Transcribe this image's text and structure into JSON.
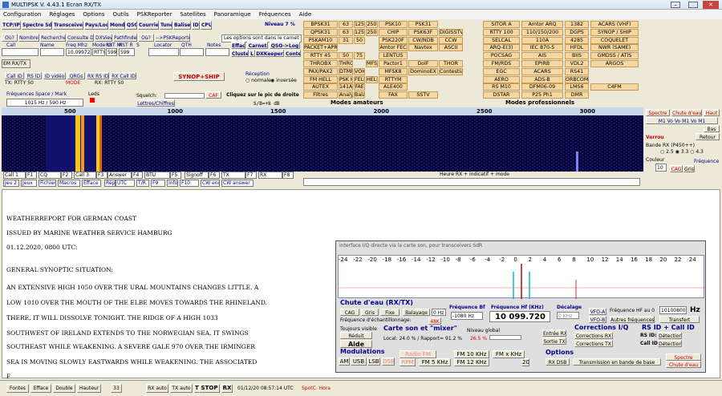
{
  "window": {
    "title": "MULTIPSK V. 4.43.1  Ecran RX/TX"
  },
  "menu": [
    "Configuration",
    "Réglages",
    "Options",
    "Outils",
    "PSKReporter",
    "Satellites",
    "Panoramique",
    "Fréquences",
    "Aide"
  ],
  "toolbar1": [
    "TCP/IP",
    "Spectre SdR",
    "Transceiver",
    "Pays/Loc",
    "Mondo",
    "QSO",
    "Courrier",
    "Tune",
    "Balise",
    "ID",
    "CPU"
  ],
  "niveau": "Niveau 7 %",
  "toolbar2": [
    "Où?",
    "Nombre?",
    "Recherche",
    "Consulte DXX",
    "DXView",
    "Pathfinder",
    "Où?",
    "-->PSKReporter"
  ],
  "options_msg": "Les options sont dans le carnet",
  "log": {
    "headers": [
      "Call",
      "Name",
      "Freq Mhz",
      "Mode Ur",
      "RST Mi",
      "RST R",
      "S",
      "Locator",
      "QTH",
      "Notes"
    ],
    "freq": "10.09972",
    "mode": "RTTY",
    "rst1": "599",
    "rst2": "599",
    "buttons": [
      "Efface",
      "Carnet",
      "QSO->Log",
      "Cluster",
      "L",
      "DXKeeper",
      "Contest"
    ]
  },
  "emrx": "EM RX/TX",
  "callbar": {
    "buttons": [
      "Call ID",
      "RS ID",
      "ID vidéo",
      "QRGs",
      "RX RS ID",
      "RX Call ID"
    ],
    "tx": "TX: RTTY 50",
    "mode": "MODE",
    "rx": "RX: RTTY 50",
    "synop": "SYNOP+SHIP",
    "reception": "Réception",
    "normale": "normale",
    "inversee": "inversée"
  },
  "freqmark": {
    "label": "Fréquences Space / Mark",
    "value": "1015 Hz / 590 Hz",
    "leds": "Leds",
    "squelch": "Squelch:",
    "caf": "CAF",
    "clickmsg": "Cliquez sur le pic de droite",
    "lettres": "Lettres/Chiffres",
    "sb": "S/B=+8 dB"
  },
  "modes_amateurs": "Modes amateurs",
  "modes_pro": "Modes professionnels",
  "mode_cols": [
    [
      "BPSK31",
      "QPSK31",
      "PSKAM10",
      "PACKET+APRS",
      "RTTY 45",
      "THROBX",
      "PAX/PAX2",
      "FM HELL",
      "AUTEX",
      "Filtres"
    ],
    [
      "63",
      "63",
      "31",
      "",
      "50",
      "THROB",
      "DTMF",
      "PSK HELL",
      "141A (ALE)",
      "Analyse"
    ],
    [
      "125",
      "125",
      "50",
      "",
      "75",
      "",
      "VOICE",
      "FELD HELL",
      "FAE",
      "Balayage"
    ],
    [
      "250",
      "250",
      "",
      "",
      "",
      "MFSK+PIC",
      "",
      "HELL 80",
      "",
      ""
    ],
    [
      "PSK10",
      "CHIP",
      "PSK220F",
      "Amtor FEC",
      "LENTUS",
      "Pactor1",
      "MFSK8",
      "RTTYM",
      "ALE400",
      "FAX"
    ],
    [
      "PSK31",
      "PSK63F",
      "CW/NDB",
      "Navtex",
      "",
      "DolF",
      "DominoEX",
      "",
      "",
      "SSTV"
    ],
    [
      "",
      "DIGISSTV",
      "CCW",
      "ASCII",
      "",
      "THOR",
      "Contestia",
      "",
      "",
      ""
    ]
  ],
  "pro_cols": [
    [
      "SITOR A",
      "RTTY 100",
      "SELCAL",
      "ARQ-E(3)",
      "POCSAG",
      "FM/RDS",
      "EGC",
      "AERO",
      "RS M10",
      "DSTAR"
    ],
    [
      "Amtor ARQ",
      "110/150/200",
      "110A",
      "IEC 870-5",
      "AIS",
      "EPIRB",
      "ACARS",
      "ADS-B",
      "DFM06-09",
      "P25 Ph1"
    ],
    [
      "1382",
      "DGPS",
      "4285",
      "HFDL",
      "BIIS",
      "VDL2",
      "RS41",
      "ORBCOMM",
      "LMS6",
      "DMR"
    ],
    [
      "ACARS (VHF)",
      "SYNOP / SHIP",
      "COQUELET",
      "NWR (SAME)",
      "GMDSS / ATIS",
      "ARGOS",
      "",
      "",
      "C4FM",
      ""
    ]
  ],
  "scale": [
    "500",
    "1000",
    "1500",
    "2000",
    "2500",
    "3000"
  ],
  "fkeys": [
    "Call 1",
    "F1",
    "CQ",
    "F2",
    "Call 3",
    "F3",
    "Answer",
    "F4",
    "BTU",
    "F5",
    "Signoff",
    "F6",
    "TX",
    "F7",
    "RX",
    "F8",
    "Jeu 2",
    "Jeux",
    "Fichier",
    "Macros",
    "Efface",
    "Répète",
    "UTC",
    "T/R",
    "F9",
    "Info",
    "F10",
    "CW end/fin",
    "CW answer"
  ],
  "heure_msg": "Heure RX + indicatif + mode",
  "right_panel": {
    "spectre": "Spectre",
    "chute": "Chute d'eau",
    "haut": "Haut",
    "bas": "Bas",
    "retour": "Retour",
    "verrou": "Verrou",
    "bande": "Bande RX (P450++)",
    "couleur": "Couleur",
    "couleur_val": "10",
    "cag": "CAG",
    "gris": "Gris",
    "frequence": "Fréquence"
  },
  "text_lines": [
    "WEATHERREPORT FOR GERMAN COAST",
    "ISSUED BY MARINE WEATHER SERVICE HAMBURG",
    "01.12.2020, 0800 UTC:",
    "GENERAL SYNOPTIC SITUATION:",
    "AN EXTENSIVE HIGH 1050 OVER THE URAL MOUNTAINS CHANGES LITTLE. A",
    "LOW 1010 OVER THE MOUTH OF THE ELBE MOVES TOWARDS THE RHINELAND.",
    "THERE, IT WILL DISSOLVE TONIGHT. THE RIDGE OF A HIGH 1033",
    "SOUTHWEST OF IRELAND EXTENDS TO THE NORWEGIAN SEA. IT SWINGS",
    "SOUTHEAST WHILE WEAKENING. A SEVERE GALE 970 OVER THE IRMINGER",
    "SEA IS MOVING SLOWLY EASTWARDS WHILE WEAKENING. THE ASSOCIATED",
    "F"
  ],
  "sdr": {
    "title": "Interface I/Q directe via la carte son, pour transceivers SdR",
    "scale": [
      "-24",
      "-22",
      "-20",
      "-18",
      "-16",
      "-14",
      "-12",
      "-10",
      "-8",
      "-6",
      "-4",
      "-2",
      "0",
      "2",
      "4",
      "6",
      "8",
      "10",
      "12",
      "14",
      "16",
      "18",
      "20",
      "22",
      "24"
    ],
    "chute_title": "Chute d'eau (RX/TX)",
    "cag": "CAG",
    "gris": "Gris",
    "fixe": "Fixe",
    "balayage": "Balayage",
    "hz0": "0 Hz",
    "freq_echant": "Fréquence d'échantillonnage:",
    "freq_echant_val": "48K",
    "freq_bf_label": "Fréquence Bf",
    "freq_bf": "-1080 Hz",
    "freq_hf_label": "Fréquence Hf (KHz)",
    "freq_hf": "10 099.720",
    "decalage": "Décalage",
    "decalage_val": "0 KHz",
    "vfo_a": "VFO-A",
    "vfo_b": "VFO-B",
    "freq_hf_au0": "Fréquence HF au 0",
    "freq_hf_au0_val": "10100800",
    "hz": "Hz",
    "autres": "Autres fréquences",
    "transfert": "Transfert",
    "toujours": "Toujours visible",
    "reduit": "Réduit",
    "aide": "Aide",
    "carte_title": "Carte son et \"mixer\"",
    "local": "Local: 24.0 % / Rapport= 91.2 %",
    "niveau_global": "Niveau global",
    "niveau_val": "26.5 %",
    "entree_rx": "Entrée RX",
    "sortie_tx": "Sortie TX",
    "corrections_title": "Corrections I/Q",
    "corr1": "Corrections RX",
    "corr2": "Corrections TX",
    "rsid_title": "RS ID + Call ID",
    "rsid": "RS ID:",
    "callid": "Call ID:",
    "detection": "Détection",
    "modulations_title": "Modulations",
    "mods": [
      "AM",
      "USB",
      "LSB",
      "DSB",
      "Radio FM",
      "FM 10 KHz",
      "FM x KHz",
      "RPM",
      "FM 5 KHz",
      "FM 12 KHz",
      "20"
    ],
    "options_title": "Options",
    "rxdsb": "RX DSB",
    "transmission": "Transmission en bande de base",
    "spectre_btn": "Spectre",
    "chute_btn": "Chute d'eau"
  },
  "bottom": {
    "items": [
      "Fontes",
      "Efface",
      "Double",
      "Hauteur",
      "33",
      "RX auto",
      "TX auto",
      "TX",
      "STOP",
      "RX"
    ],
    "datetime": "01/12/20 08:57:14 UTC",
    "spotc": "SpotC. Hora"
  }
}
